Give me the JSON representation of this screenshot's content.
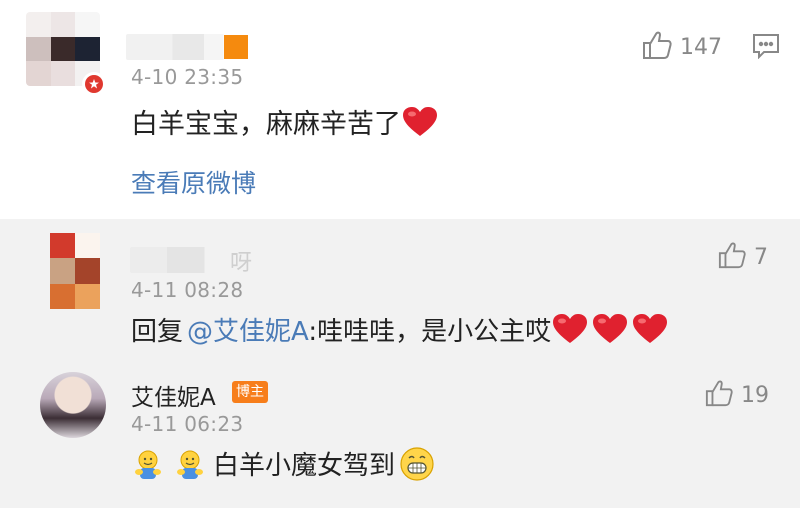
{
  "colors": {
    "link": "#4a7bb7",
    "time": "#999999",
    "heart": "#e0212f",
    "host_badge": "#f77e1b",
    "reply_bg": "#f2f2f2"
  },
  "main_comment": {
    "time": "4-10 23:35",
    "text": "白羊宝宝，麻麻辛苦了",
    "likes": "147",
    "view_original": "查看原微博",
    "icons": [
      "thumbs-up-icon",
      "comment-icon",
      "heart-icon",
      "verified-badge-icon"
    ]
  },
  "replies": [
    {
      "name_visible": "呀",
      "time": "4-11 08:28",
      "prefix": "回复",
      "mention": "@艾佳妮A",
      "text": ":哇哇哇，是小公主哎",
      "likes": "7",
      "hearts": 3
    },
    {
      "name": "艾佳妮A",
      "badge": "博主",
      "time": "4-11 06:23",
      "text": "白羊小魔女驾到",
      "likes": "19",
      "icons": [
        "hug-emoji-icon",
        "hug-emoji-icon",
        "grin-emoji-icon"
      ]
    }
  ]
}
